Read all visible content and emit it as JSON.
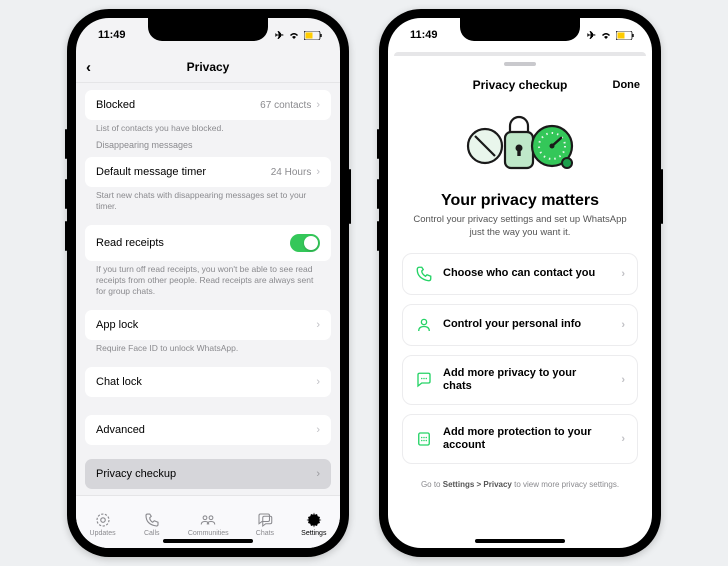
{
  "status": {
    "time": "11:49"
  },
  "left": {
    "title": "Privacy",
    "blocked": {
      "label": "Blocked",
      "value": "67 contacts",
      "caption": "List of contacts you have blocked."
    },
    "disappearing_head": "Disappearing messages",
    "timer": {
      "label": "Default message timer",
      "value": "24 Hours",
      "caption": "Start new chats with disappearing messages set to your timer."
    },
    "receipts": {
      "label": "Read receipts",
      "caption": "If you turn off read receipts, you won't be able to see read receipts from other people. Read receipts are always sent for group chats."
    },
    "applock": {
      "label": "App lock",
      "caption": "Require Face ID to unlock WhatsApp."
    },
    "chatlock": {
      "label": "Chat lock"
    },
    "advanced": {
      "label": "Advanced"
    },
    "checkup": {
      "label": "Privacy checkup"
    },
    "tabs": {
      "t0": "Updates",
      "t1": "Calls",
      "t2": "Communities",
      "t3": "Chats",
      "t4": "Settings"
    }
  },
  "right": {
    "title": "Privacy checkup",
    "done": "Done",
    "hero_title": "Your privacy matters",
    "hero_sub": "Control your privacy settings and set up WhatsApp just the way you want it.",
    "c1": "Choose who can contact you",
    "c2": "Control your personal info",
    "c3": "Add more privacy to your chats",
    "c4": "Add more protection to your account",
    "foot_pre": "Go to ",
    "foot_path": "Settings > Privacy",
    "foot_post": " to view more privacy settings."
  }
}
